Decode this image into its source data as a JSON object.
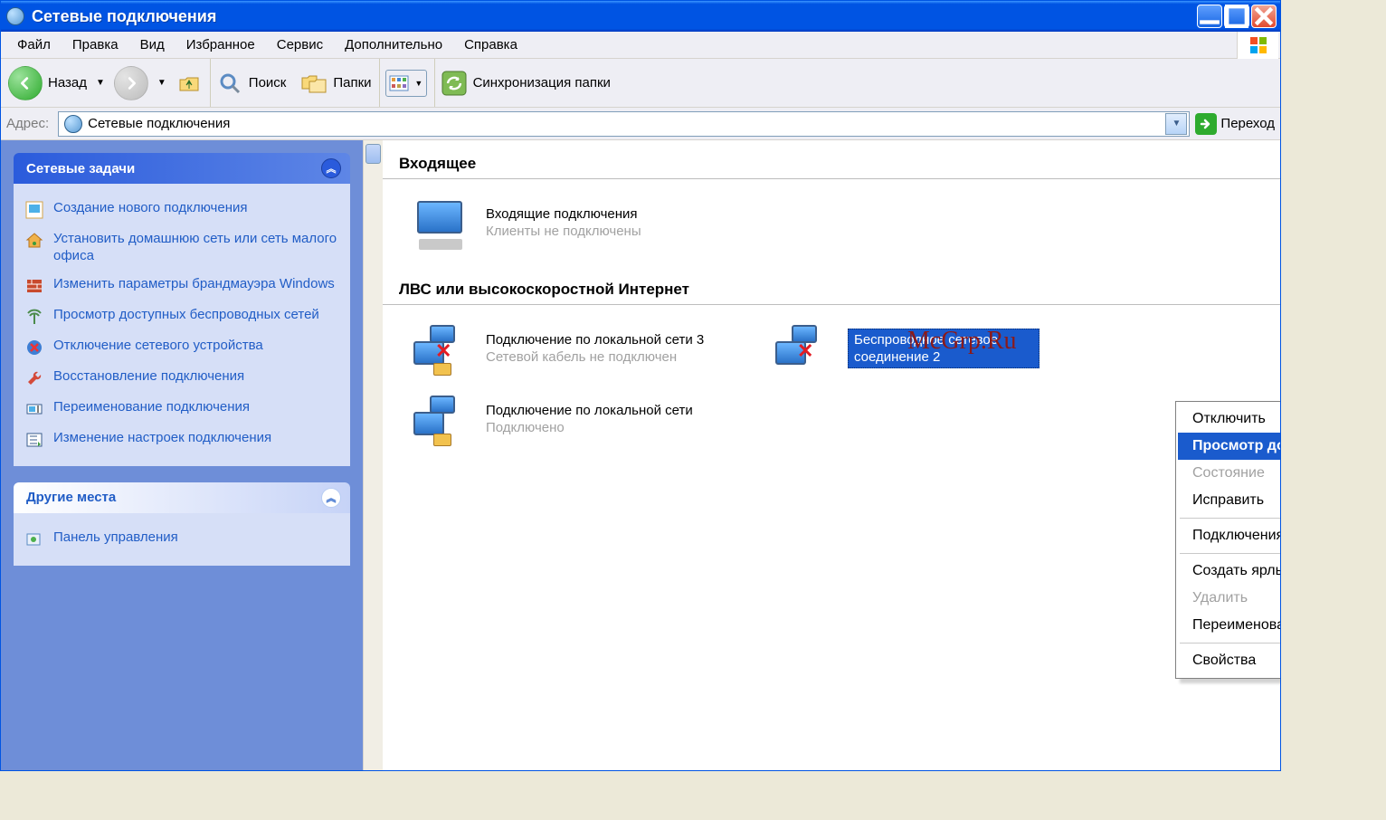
{
  "window": {
    "title": "Сетевые подключения"
  },
  "menu": {
    "items": [
      "Файл",
      "Правка",
      "Вид",
      "Избранное",
      "Сервис",
      "Дополнительно",
      "Справка"
    ]
  },
  "toolbar": {
    "back_label": "Назад",
    "search_label": "Поиск",
    "folders_label": "Папки",
    "sync_label": "Синхронизация папки"
  },
  "address": {
    "label": "Адрес:",
    "value": "Сетевые подключения",
    "go_label": "Переход"
  },
  "sidebar": {
    "tasks_title": "Сетевые задачи",
    "tasks": [
      "Создание нового подключения",
      "Установить домашнюю сеть или сеть малого офиса",
      "Изменить параметры брандмауэра Windows",
      "Просмотр доступных беспроводных сетей",
      "Отключение сетевого устройства",
      "Восстановление подключения",
      "Переименование подключения",
      "Изменение настроек подключения"
    ],
    "places_title": "Другие места",
    "places": [
      "Панель управления"
    ]
  },
  "content": {
    "group1_title": "Входящее",
    "incoming": {
      "name": "Входящие подключения",
      "sub": "Клиенты не подключены"
    },
    "group2_title": "ЛВС или высокоскоростной Интернет",
    "lan3": {
      "name": "Подключение по локальной сети 3",
      "sub": "Сетевой кабель не подключен"
    },
    "lan": {
      "name": "Подключение по локальной сети",
      "sub": "Подключено"
    },
    "wlan": {
      "name": "Беспроводное сетевое соединение 2"
    }
  },
  "context_menu": {
    "items": [
      {
        "label": "Отключить",
        "group": 1,
        "selected": false,
        "disabled": false
      },
      {
        "label": "Просмотр доступных беспроводных сетей",
        "group": 1,
        "selected": true,
        "disabled": false
      },
      {
        "label": "Состояние",
        "group": 1,
        "selected": false,
        "disabled": true
      },
      {
        "label": "Исправить",
        "group": 1,
        "selected": false,
        "disabled": false
      },
      {
        "label": "Подключения типа мост",
        "group": 2,
        "selected": false,
        "disabled": false
      },
      {
        "label": "Создать ярлык",
        "group": 3,
        "selected": false,
        "disabled": false
      },
      {
        "label": "Удалить",
        "group": 3,
        "selected": false,
        "disabled": true
      },
      {
        "label": "Переименовать",
        "group": 3,
        "selected": false,
        "disabled": false
      },
      {
        "label": "Свойства",
        "group": 4,
        "selected": false,
        "disabled": false
      }
    ]
  },
  "watermark": "McGrp.Ru"
}
